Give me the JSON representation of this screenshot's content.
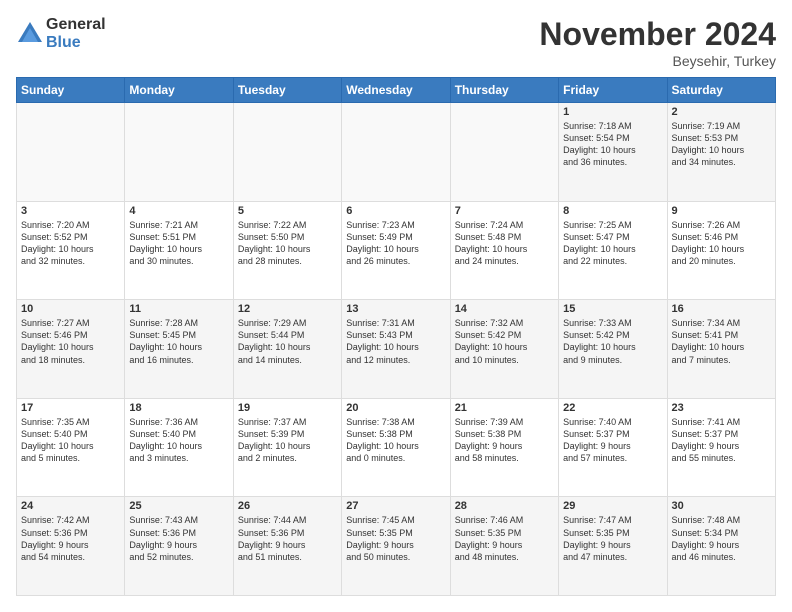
{
  "logo": {
    "general": "General",
    "blue": "Blue"
  },
  "title": {
    "month": "November 2024",
    "location": "Beysehir, Turkey"
  },
  "headers": [
    "Sunday",
    "Monday",
    "Tuesday",
    "Wednesday",
    "Thursday",
    "Friday",
    "Saturday"
  ],
  "weeks": [
    [
      {
        "day": "",
        "info": ""
      },
      {
        "day": "",
        "info": ""
      },
      {
        "day": "",
        "info": ""
      },
      {
        "day": "",
        "info": ""
      },
      {
        "day": "",
        "info": ""
      },
      {
        "day": "1",
        "info": "Sunrise: 7:18 AM\nSunset: 5:54 PM\nDaylight: 10 hours\nand 36 minutes."
      },
      {
        "day": "2",
        "info": "Sunrise: 7:19 AM\nSunset: 5:53 PM\nDaylight: 10 hours\nand 34 minutes."
      }
    ],
    [
      {
        "day": "3",
        "info": "Sunrise: 7:20 AM\nSunset: 5:52 PM\nDaylight: 10 hours\nand 32 minutes."
      },
      {
        "day": "4",
        "info": "Sunrise: 7:21 AM\nSunset: 5:51 PM\nDaylight: 10 hours\nand 30 minutes."
      },
      {
        "day": "5",
        "info": "Sunrise: 7:22 AM\nSunset: 5:50 PM\nDaylight: 10 hours\nand 28 minutes."
      },
      {
        "day": "6",
        "info": "Sunrise: 7:23 AM\nSunset: 5:49 PM\nDaylight: 10 hours\nand 26 minutes."
      },
      {
        "day": "7",
        "info": "Sunrise: 7:24 AM\nSunset: 5:48 PM\nDaylight: 10 hours\nand 24 minutes."
      },
      {
        "day": "8",
        "info": "Sunrise: 7:25 AM\nSunset: 5:47 PM\nDaylight: 10 hours\nand 22 minutes."
      },
      {
        "day": "9",
        "info": "Sunrise: 7:26 AM\nSunset: 5:46 PM\nDaylight: 10 hours\nand 20 minutes."
      }
    ],
    [
      {
        "day": "10",
        "info": "Sunrise: 7:27 AM\nSunset: 5:46 PM\nDaylight: 10 hours\nand 18 minutes."
      },
      {
        "day": "11",
        "info": "Sunrise: 7:28 AM\nSunset: 5:45 PM\nDaylight: 10 hours\nand 16 minutes."
      },
      {
        "day": "12",
        "info": "Sunrise: 7:29 AM\nSunset: 5:44 PM\nDaylight: 10 hours\nand 14 minutes."
      },
      {
        "day": "13",
        "info": "Sunrise: 7:31 AM\nSunset: 5:43 PM\nDaylight: 10 hours\nand 12 minutes."
      },
      {
        "day": "14",
        "info": "Sunrise: 7:32 AM\nSunset: 5:42 PM\nDaylight: 10 hours\nand 10 minutes."
      },
      {
        "day": "15",
        "info": "Sunrise: 7:33 AM\nSunset: 5:42 PM\nDaylight: 10 hours\nand 9 minutes."
      },
      {
        "day": "16",
        "info": "Sunrise: 7:34 AM\nSunset: 5:41 PM\nDaylight: 10 hours\nand 7 minutes."
      }
    ],
    [
      {
        "day": "17",
        "info": "Sunrise: 7:35 AM\nSunset: 5:40 PM\nDaylight: 10 hours\nand 5 minutes."
      },
      {
        "day": "18",
        "info": "Sunrise: 7:36 AM\nSunset: 5:40 PM\nDaylight: 10 hours\nand 3 minutes."
      },
      {
        "day": "19",
        "info": "Sunrise: 7:37 AM\nSunset: 5:39 PM\nDaylight: 10 hours\nand 2 minutes."
      },
      {
        "day": "20",
        "info": "Sunrise: 7:38 AM\nSunset: 5:38 PM\nDaylight: 10 hours\nand 0 minutes."
      },
      {
        "day": "21",
        "info": "Sunrise: 7:39 AM\nSunset: 5:38 PM\nDaylight: 9 hours\nand 58 minutes."
      },
      {
        "day": "22",
        "info": "Sunrise: 7:40 AM\nSunset: 5:37 PM\nDaylight: 9 hours\nand 57 minutes."
      },
      {
        "day": "23",
        "info": "Sunrise: 7:41 AM\nSunset: 5:37 PM\nDaylight: 9 hours\nand 55 minutes."
      }
    ],
    [
      {
        "day": "24",
        "info": "Sunrise: 7:42 AM\nSunset: 5:36 PM\nDaylight: 9 hours\nand 54 minutes."
      },
      {
        "day": "25",
        "info": "Sunrise: 7:43 AM\nSunset: 5:36 PM\nDaylight: 9 hours\nand 52 minutes."
      },
      {
        "day": "26",
        "info": "Sunrise: 7:44 AM\nSunset: 5:36 PM\nDaylight: 9 hours\nand 51 minutes."
      },
      {
        "day": "27",
        "info": "Sunrise: 7:45 AM\nSunset: 5:35 PM\nDaylight: 9 hours\nand 50 minutes."
      },
      {
        "day": "28",
        "info": "Sunrise: 7:46 AM\nSunset: 5:35 PM\nDaylight: 9 hours\nand 48 minutes."
      },
      {
        "day": "29",
        "info": "Sunrise: 7:47 AM\nSunset: 5:35 PM\nDaylight: 9 hours\nand 47 minutes."
      },
      {
        "day": "30",
        "info": "Sunrise: 7:48 AM\nSunset: 5:34 PM\nDaylight: 9 hours\nand 46 minutes."
      }
    ]
  ]
}
